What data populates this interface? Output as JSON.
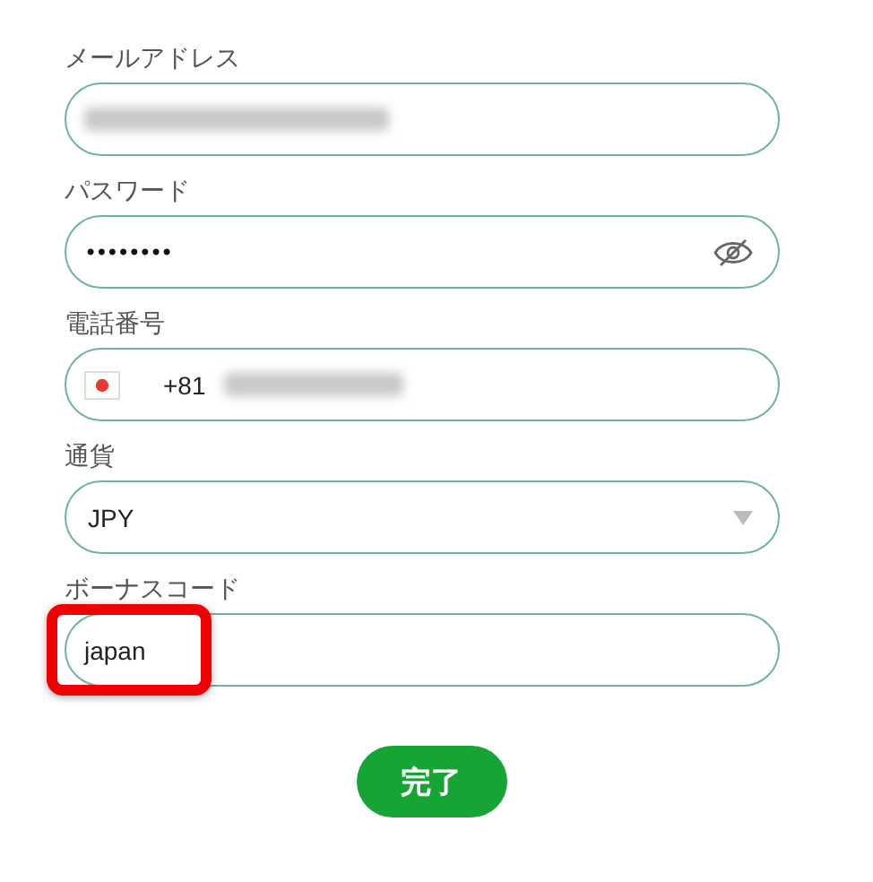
{
  "fields": [
    {
      "kind": "text",
      "label": "メールアドレス",
      "redacted": true
    },
    {
      "kind": "password",
      "label": "パスワード",
      "value": "••••••••"
    },
    {
      "kind": "phone",
      "label": "電話番号",
      "prefix": "+81",
      "redacted": true
    },
    {
      "kind": "select",
      "label": "通貨",
      "value": "JPY"
    },
    {
      "kind": "text",
      "label": "ボーナスコード",
      "value": "japan",
      "highlighted": true
    }
  ],
  "submit": {
    "label": "完了"
  }
}
